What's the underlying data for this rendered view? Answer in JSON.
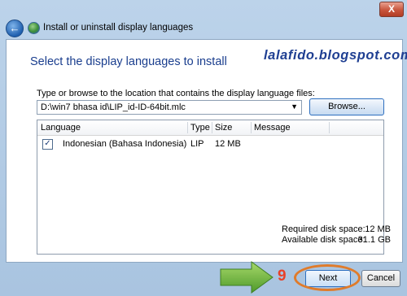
{
  "window": {
    "title": "Install or uninstall display languages",
    "close_label": "X"
  },
  "watermark": "lalafido.blogspot.com",
  "page": {
    "heading": "Select the display languages to install"
  },
  "path": {
    "label": "Type or browse to the location that contains the display language files:",
    "value": "D:\\win7 bhasa id\\LIP_id-ID-64bit.mlc",
    "browse_label": "Browse..."
  },
  "table": {
    "columns": [
      "Language",
      "Type",
      "Size",
      "Message"
    ],
    "rows": [
      {
        "checked": true,
        "language": "Indonesian (Bahasa Indonesia)",
        "type": "LIP",
        "size": "12 MB",
        "message": ""
      }
    ]
  },
  "disk": {
    "required_label": "Required disk space:",
    "required_value": "12 MB",
    "available_label": "Available disk space:",
    "available_value": "31.1 GB"
  },
  "footer": {
    "step_number": "9",
    "next_label": "Next",
    "cancel_label": "Cancel"
  },
  "colors": {
    "heading": "#1a3e8e",
    "annotation_ring": "#e07b2a",
    "arrow": "#6bb33a",
    "step_number": "#e8412a"
  }
}
